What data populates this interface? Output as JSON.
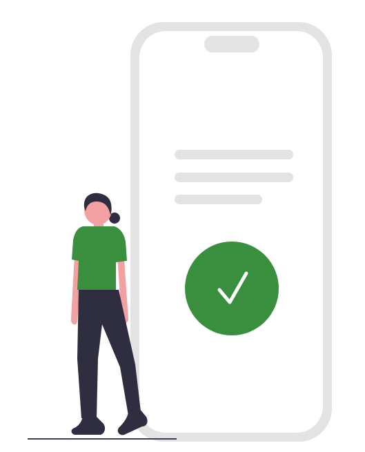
{
  "illustration": {
    "colors": {
      "phone_frame": "#e3e3e3",
      "phone_screen": "#ffffff",
      "notch": "#e3e3e3",
      "text_placeholder": "#e3e3e3",
      "check_circle": "#3a8f3f",
      "check_mark": "#ffffff",
      "shirt": "#3a8f3f",
      "skin": "#f2a0a1",
      "hair": "#2f2e41",
      "pants": "#2f2e41",
      "shoes": "#2f2e41",
      "ground_line": "#3f3d56"
    },
    "icons": [
      "smartphone-icon",
      "check-circle-icon",
      "person-figure"
    ]
  }
}
